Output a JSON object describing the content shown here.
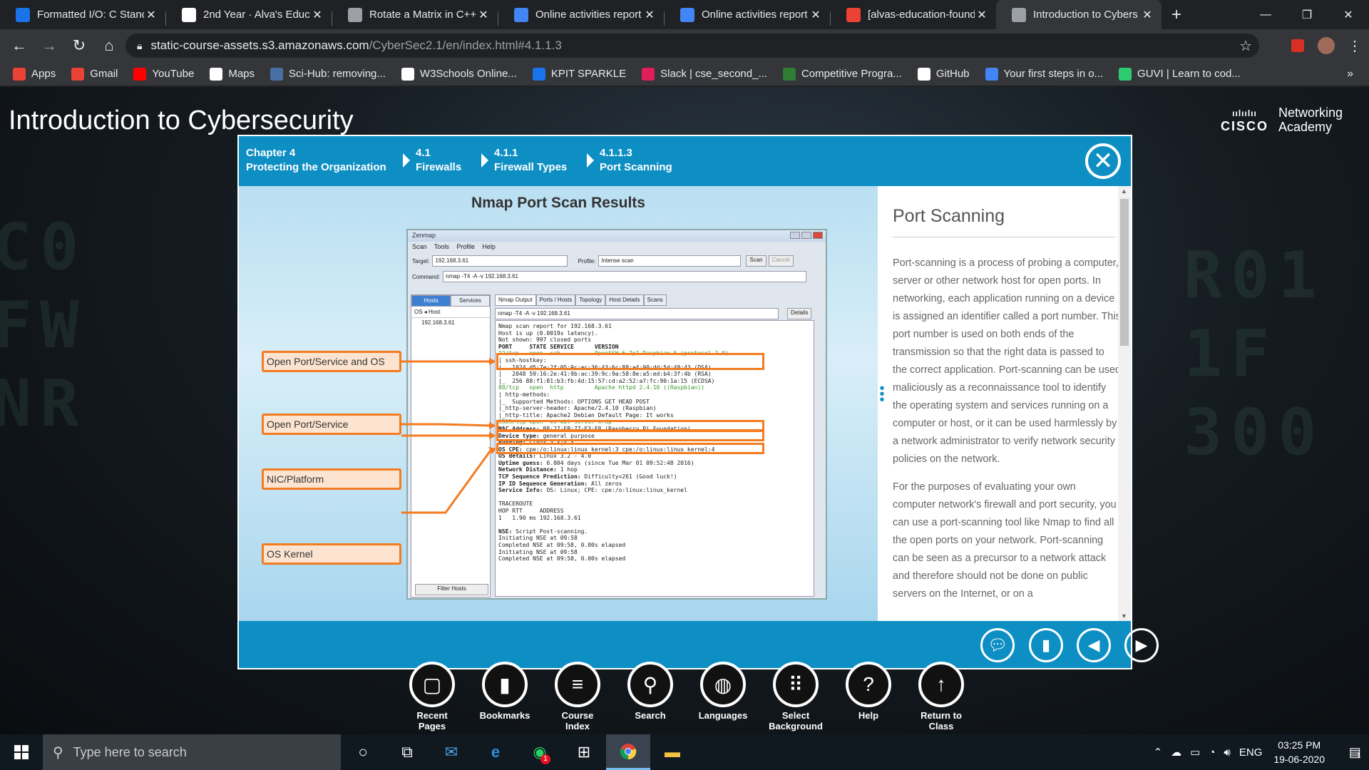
{
  "browser": {
    "tabs": [
      {
        "title": "Formatted I/O: C Stand",
        "icon": "doc-icon",
        "color": "#1a73e8"
      },
      {
        "title": "2nd Year · Alva's Educa",
        "icon": "github-icon",
        "color": "#ffffff"
      },
      {
        "title": "Rotate a Matrix in C++",
        "icon": "globe-icon",
        "color": "#9aa0a6"
      },
      {
        "title": "Online activities report",
        "icon": "docs-icon",
        "color": "#4285f4"
      },
      {
        "title": "Online activities report",
        "icon": "docs-icon",
        "color": "#4285f4"
      },
      {
        "title": "[alvas-education-found",
        "icon": "gmail-icon",
        "color": "#ea4335"
      },
      {
        "title": "Introduction to Cybers",
        "icon": "globe-icon",
        "color": "#9aa0a6",
        "active": true
      }
    ],
    "url_host": "static-course-assets.s3.amazonaws.com",
    "url_path": "/CyberSec2.1/en/index.html#4.1.1.3",
    "bookmarks": [
      {
        "label": "Apps",
        "icon": "apps-icon",
        "color": "#ea4335"
      },
      {
        "label": "Gmail",
        "icon": "gmail-icon",
        "color": "#ea4335"
      },
      {
        "label": "YouTube",
        "icon": "youtube-icon",
        "color": "#ff0000"
      },
      {
        "label": "Maps",
        "icon": "maps-icon",
        "color": "#ffffff"
      },
      {
        "label": "Sci-Hub: removing...",
        "icon": "scihub-icon",
        "color": "#4a6fa5"
      },
      {
        "label": "W3Schools Online...",
        "icon": "globe-icon",
        "color": "#ffffff"
      },
      {
        "label": "KPIT SPARKLE",
        "icon": "kpit-icon",
        "color": "#1a73e8"
      },
      {
        "label": "Slack | cse_second_...",
        "icon": "slack-icon",
        "color": "#e01e5a"
      },
      {
        "label": "Competitive Progra...",
        "icon": "code-icon",
        "color": "#2e7d32"
      },
      {
        "label": "GitHub",
        "icon": "github-icon",
        "color": "#ffffff"
      },
      {
        "label": "Your first steps in o...",
        "icon": "google-icon",
        "color": "#4285f4"
      },
      {
        "label": "GUVI | Learn to cod...",
        "icon": "guvi-icon",
        "color": "#2ecc71"
      }
    ],
    "bookmarks_more": "»"
  },
  "course": {
    "title": "Introduction to Cybersecurity",
    "brand_top": "Networking",
    "brand_bottom": "Academy",
    "brand_logo": "CISCO",
    "breadcrumb": [
      {
        "num": "Chapter 4",
        "name": "Protecting the Organization"
      },
      {
        "num": "4.1",
        "name": "Firewalls"
      },
      {
        "num": "4.1.1",
        "name": "Firewall Types"
      },
      {
        "num": "4.1.1.3",
        "name": "Port Scanning"
      }
    ],
    "accent": "#0e8fc4"
  },
  "figure": {
    "title": "Nmap Port Scan Results",
    "callouts": [
      "Open Port/Service and OS",
      "Open Port/Service",
      "NIC/Platform",
      "OS Kernel"
    ],
    "zenmap": {
      "window_title": "Zenmap",
      "menu": "Scan Tools Profile Help",
      "target_label": "Target:",
      "target_value": "192.168.3.61",
      "profile_label": "Profile:",
      "profile_value": "Intense scan",
      "scan_btn": "Scan",
      "cancel_btn": "Cancel",
      "command_label": "Command:",
      "command_value": "nmap -T4 -A -v 192.168.3.61",
      "host_tabs": [
        "Hosts",
        "Services"
      ],
      "os_host_header": "OS ◂ Host",
      "host_entry": "192.168.3.61",
      "filter_btn": "Filter Hosts",
      "output_tabs": [
        "Nmap Output",
        "Ports / Hosts",
        "Topology",
        "Host Details",
        "Scans"
      ],
      "output_select": "nmap -T4 -A -v 192.168.3.61",
      "details_btn": "Details"
    }
  },
  "panel": {
    "title": "Port Scanning",
    "paragraphs": [
      "Port-scanning is a process of probing a computer, server or other network host for open ports. In networking, each application running on a device is assigned an identifier called a port number. This port number is used on both ends of the transmission so that the right data is passed to the correct application. Port-scanning can be used maliciously as a reconnaissance tool to identify the operating system and services running on a computer or host, or it can be used harmlessly by a network administrator to verify network security policies on the network.",
      "For the purposes of evaluating your own computer network's firewall and port security, you can use a port-scanning tool like Nmap to find all the open ports on your network. Port-scanning can be seen as a precursor to a network attack and therefore should not be done on public servers on the Internet, or on a"
    ]
  },
  "footer_buttons": [
    {
      "name": "comment",
      "icon": "chat-icon"
    },
    {
      "name": "bookmark",
      "icon": "bookmark-icon"
    },
    {
      "name": "previous",
      "icon": "arrow-left-icon"
    },
    {
      "name": "next",
      "icon": "arrow-right-icon"
    }
  ],
  "dock": [
    {
      "label1": "Recent",
      "label2": "Pages",
      "icon": "pages-icon",
      "glyph": "▢"
    },
    {
      "label1": "Bookmarks",
      "label2": "",
      "icon": "bookmark-icon",
      "glyph": "▮"
    },
    {
      "label1": "Course",
      "label2": "Index",
      "icon": "menu-icon",
      "glyph": "≡"
    },
    {
      "label1": "Search",
      "label2": "",
      "icon": "search-icon",
      "glyph": "⚲"
    },
    {
      "label1": "Languages",
      "label2": "",
      "icon": "globe-icon",
      "glyph": "◍"
    },
    {
      "label1": "Select",
      "label2": "Background",
      "icon": "grid-icon",
      "glyph": "⠿"
    },
    {
      "label1": "Help",
      "label2": "",
      "icon": "help-icon",
      "glyph": "?"
    },
    {
      "label1": "Return to",
      "label2": "Class",
      "icon": "up-arrow-icon",
      "glyph": "↑"
    }
  ],
  "taskbar": {
    "search_placeholder": "Type here to search",
    "lang": "ENG",
    "time": "03:25 PM",
    "date": "19-06-2020",
    "notif_count": "1",
    "whatsapp_badge": "1"
  }
}
